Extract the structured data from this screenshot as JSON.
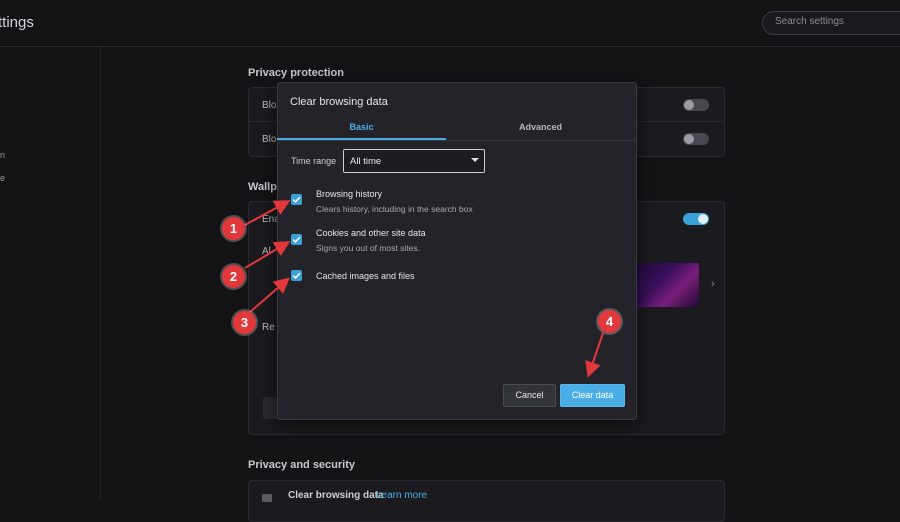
{
  "app": {
    "title": "ttings"
  },
  "search": {
    "placeholder": "Search settings"
  },
  "sidebar": {
    "fragments": [
      "n",
      "e"
    ]
  },
  "background": {
    "sections": [
      {
        "title": "Privacy protection",
        "rows": [
          "Blo",
          "Blo"
        ]
      },
      {
        "title": "Wallp",
        "rows": [
          "Ena",
          "Al",
          "Re"
        ]
      },
      {
        "title": "Privacy and security",
        "rows": [
          "Clear browsing data"
        ]
      }
    ],
    "learn_more": "Learn more"
  },
  "modal": {
    "title": "Clear browsing data",
    "tabs": [
      {
        "label": "Basic",
        "active": true
      },
      {
        "label": "Advanced",
        "active": false
      }
    ],
    "time_range": {
      "label": "Time range",
      "value": "All time"
    },
    "options": [
      {
        "title": "Browsing history",
        "description": "Clears history, including in the search box",
        "checked": true
      },
      {
        "title": "Cookies and other site data",
        "description": "Signs you out of most sites.",
        "checked": true
      },
      {
        "title": "Cached images and files",
        "description": "",
        "checked": true
      }
    ],
    "buttons": {
      "cancel": "Cancel",
      "clear": "Clear data"
    }
  },
  "annotations": {
    "markers": [
      "1",
      "2",
      "3",
      "4"
    ],
    "color": "#e3383b"
  },
  "colors": {
    "accent": "#4aaee6",
    "background": "#141417",
    "modal": "#232329"
  }
}
